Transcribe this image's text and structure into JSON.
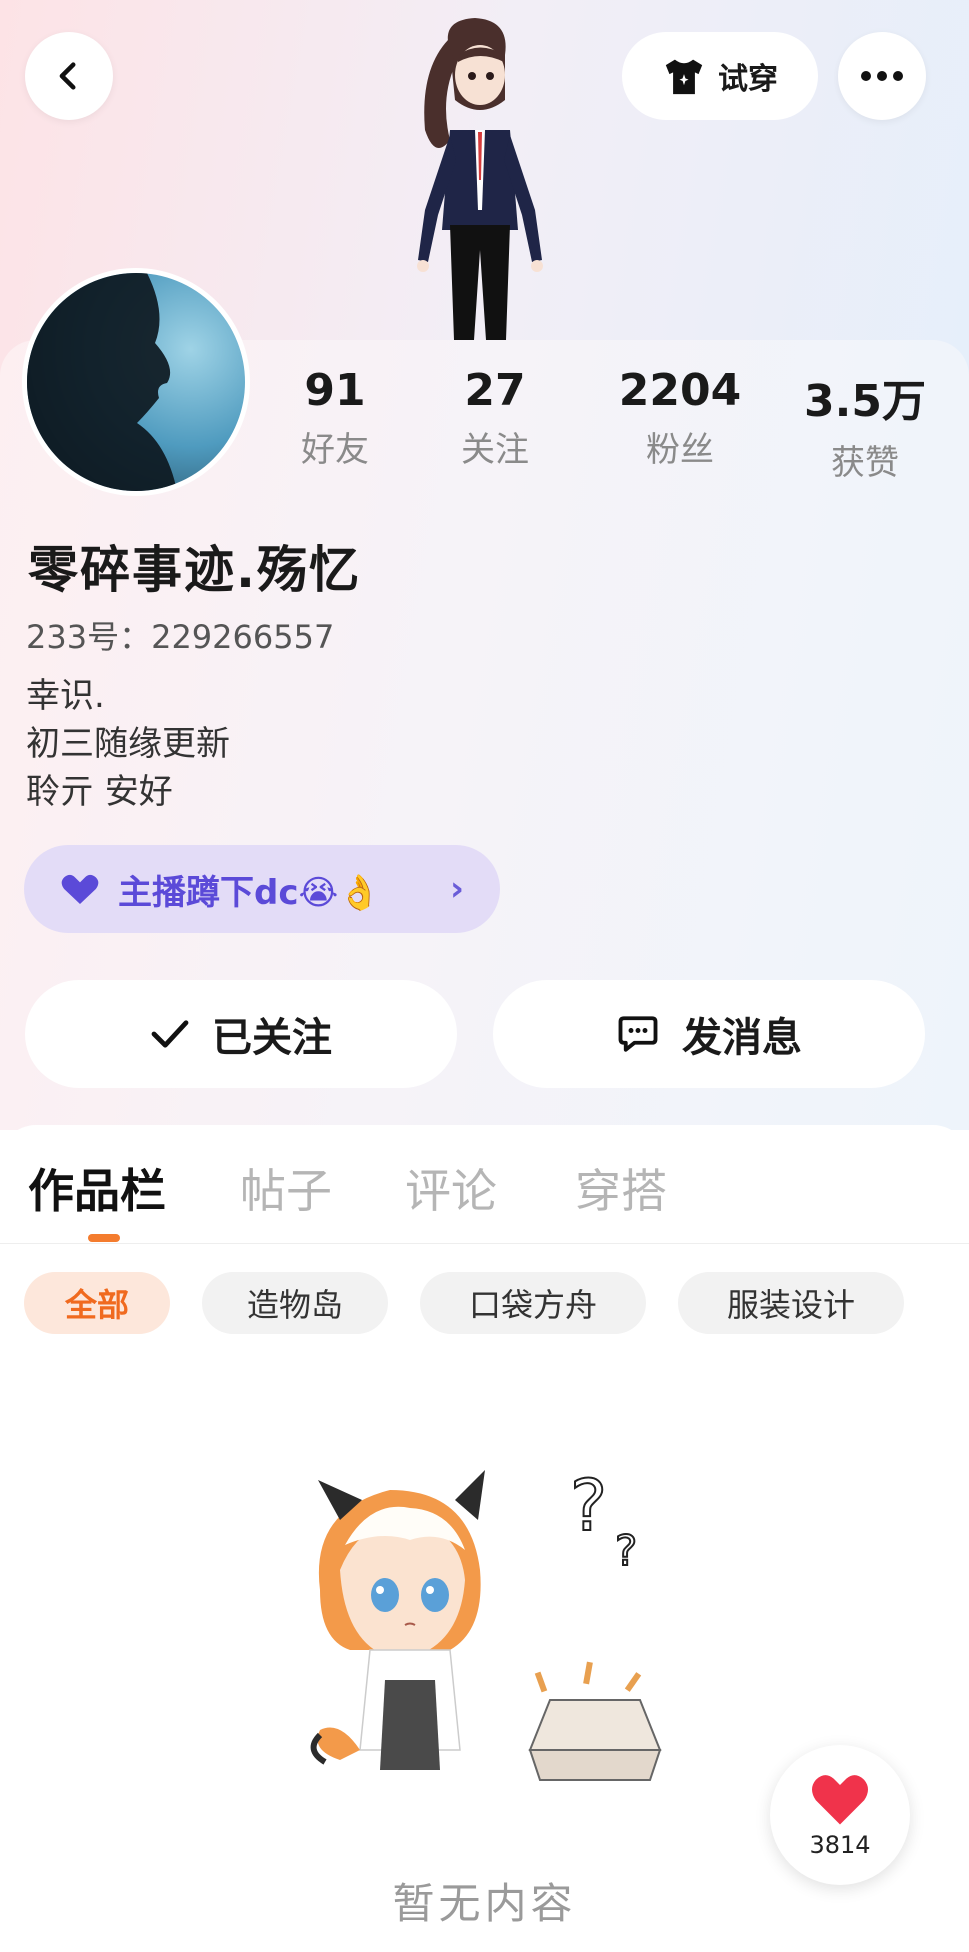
{
  "header": {
    "try_on_label": "试穿",
    "icons": {
      "back": "chevron-left-icon",
      "tshirt": "tshirt-icon",
      "more": "more-dots-icon"
    }
  },
  "profile": {
    "stats": [
      {
        "value": "91",
        "label": "好友"
      },
      {
        "value": "27",
        "label": "关注"
      },
      {
        "value": "2204",
        "label": "粉丝"
      },
      {
        "value": "3.5万",
        "label": "获赞"
      }
    ],
    "nickname": "零碎事迹.殇忆",
    "uid": "233号：229266557",
    "bio": [
      "幸识.",
      "初三随缘更新",
      "聆亓 安好"
    ],
    "tag": "主播蹲下dc😭👌",
    "follow_label": "已关注",
    "message_label": "发消息"
  },
  "tabs": [
    "作品栏",
    "帖子",
    "评论",
    "穿搭"
  ],
  "filters": [
    "全部",
    "造物岛",
    "口袋方舟",
    "服装设计"
  ],
  "empty_text": "暂无内容",
  "like_count": "3814",
  "colors": {
    "accent": "#f47c2e",
    "tag_text": "#5b4ad8",
    "tag_bg": "#e3dcf7",
    "like_red": "#f0334b"
  }
}
